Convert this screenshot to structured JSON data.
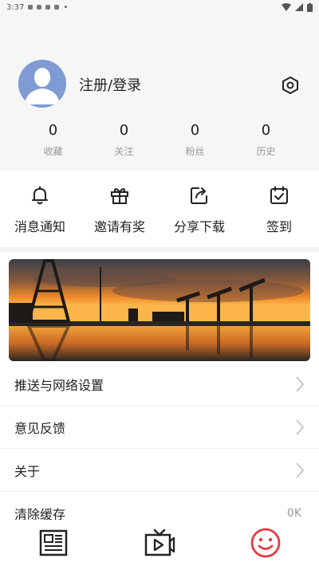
{
  "status_bar": {
    "time": "3:37"
  },
  "profile": {
    "login_label": "注册/登录",
    "stats": [
      {
        "value": "0",
        "label": "收藏"
      },
      {
        "value": "0",
        "label": "关注"
      },
      {
        "value": "0",
        "label": "粉丝"
      },
      {
        "value": "0",
        "label": "历史"
      }
    ]
  },
  "quick_actions": [
    {
      "label": "消息通知",
      "icon": "bell-icon"
    },
    {
      "label": "邀请有奖",
      "icon": "gift-icon"
    },
    {
      "label": "分享下载",
      "icon": "share-icon"
    },
    {
      "label": "签到",
      "icon": "calendar-check-icon"
    }
  ],
  "menu": [
    {
      "label": "推送与网络设置",
      "value": ""
    },
    {
      "label": "意见反馈",
      "value": ""
    },
    {
      "label": "关于",
      "value": ""
    },
    {
      "label": "清除缓存",
      "value": "0K"
    }
  ],
  "tabbar": [
    {
      "icon": "news-icon"
    },
    {
      "icon": "video-icon"
    },
    {
      "icon": "smile-icon"
    }
  ],
  "colors": {
    "accent": "#e8393f",
    "avatar": "#7f9bd3",
    "header_bg": "#f6f6f6"
  }
}
